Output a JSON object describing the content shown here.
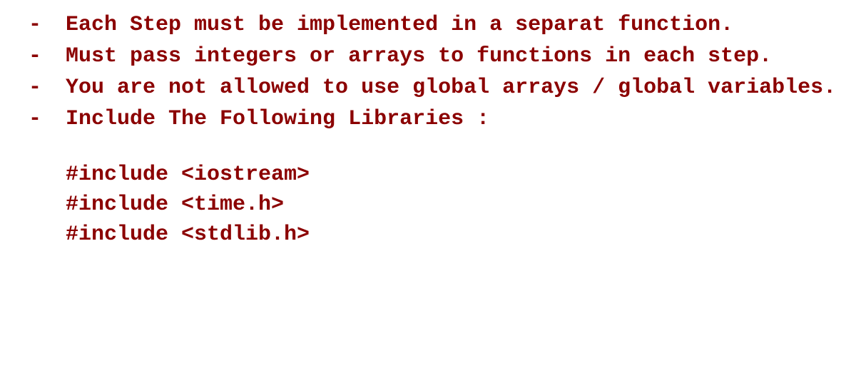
{
  "bullets": {
    "marker": "-",
    "item1": "Each Step must be implemented in a separat function.",
    "item2": "Must pass integers or arrays to functions in each step.",
    "item3": "You are not allowed to use global arrays / global variables.",
    "item4": "Include The Following Libraries  :"
  },
  "code": {
    "line1": "#include <iostream>",
    "line2": "#include <time.h>",
    "line3": "#include <stdlib.h>"
  }
}
